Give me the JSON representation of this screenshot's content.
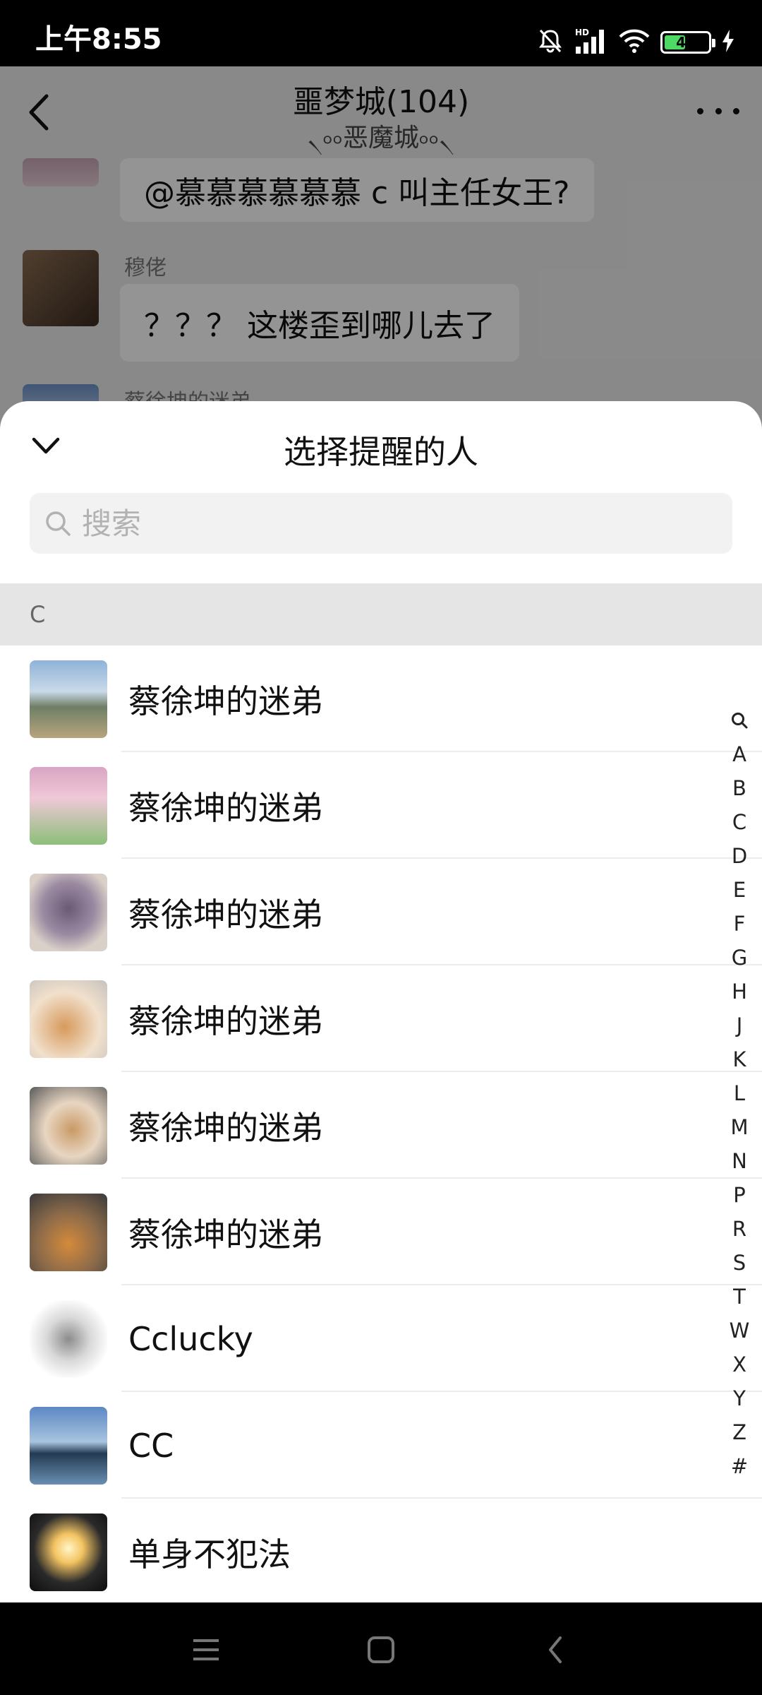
{
  "status_bar": {
    "time": "上午8:55",
    "battery": 49,
    "network": "HD"
  },
  "chat": {
    "title": "噩梦城(104)",
    "subtitle": "৲৹৹恶魔城৹৹৲",
    "messages": [
      {
        "sender": "",
        "text": "@慕慕慕慕慕慕 c  叫主任女王?"
      },
      {
        "sender": "穆佬",
        "text": "？？？ 这楼歪到哪儿去了"
      },
      {
        "sender": "蔡徐坤的迷弟",
        "text": ""
      }
    ]
  },
  "sheet": {
    "title": "选择提醒的人",
    "search_placeholder": "搜索",
    "section": "C",
    "members": [
      {
        "name": "蔡徐坤的迷弟",
        "avatar": "landscape-photo"
      },
      {
        "name": "蔡徐坤的迷弟",
        "avatar": "girl-photo"
      },
      {
        "name": "蔡徐坤的迷弟",
        "avatar": "cartoon-egg"
      },
      {
        "name": "蔡徐坤的迷弟",
        "avatar": "shiba-dog"
      },
      {
        "name": "蔡徐坤的迷弟",
        "avatar": "dog-headphones"
      },
      {
        "name": "蔡徐坤的迷弟",
        "avatar": "cat-hat"
      },
      {
        "name": "Cclucky",
        "avatar": "silhouette-figure"
      },
      {
        "name": "CC",
        "avatar": "lake-sky"
      },
      {
        "name": "单身不犯法",
        "avatar": "runner-moon"
      }
    ],
    "index_letters": [
      "A",
      "B",
      "C",
      "D",
      "E",
      "F",
      "G",
      "H",
      "J",
      "K",
      "L",
      "M",
      "N",
      "P",
      "R",
      "S",
      "T",
      "W",
      "X",
      "Y",
      "Z",
      "#"
    ]
  },
  "colors": {
    "accent": "#4cd964",
    "sheet_bg": "#ffffff",
    "section_bg": "#e5e5e5",
    "chat_bg": "#ededed"
  }
}
